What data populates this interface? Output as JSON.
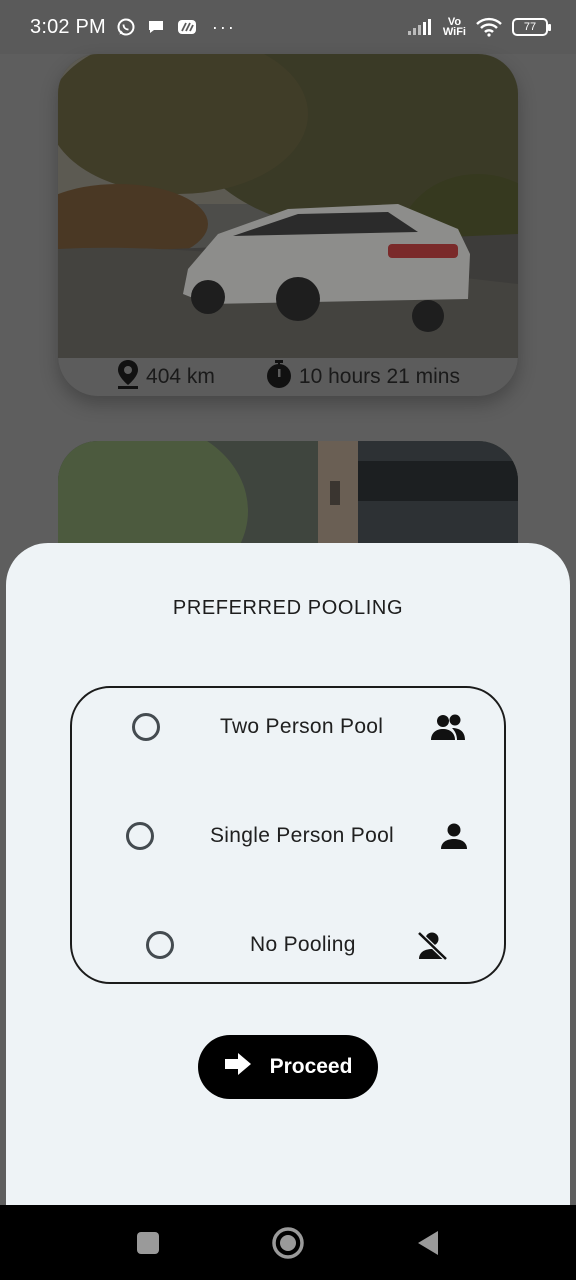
{
  "status_bar": {
    "time": "3:02 PM",
    "dots": "···",
    "network": "Vo WiFi",
    "network_line1": "Vo",
    "network_line2": "WiFi",
    "battery": "77",
    "icons": [
      "whatsapp-icon",
      "chat-bubble-icon",
      "app-icon",
      "signal-icon",
      "wifi-icon",
      "battery-icon"
    ]
  },
  "background": {
    "car_card": {
      "distance": "404 km",
      "duration": "10 hours 21 mins",
      "icons": [
        "location-pin-icon",
        "stopwatch-icon"
      ]
    }
  },
  "sheet": {
    "title": "PREFERRED POOLING",
    "options": [
      {
        "label": "Two Person Pool",
        "icon": "people-icon",
        "selected": false
      },
      {
        "label": "Single Person Pool",
        "icon": "person-icon",
        "selected": false
      },
      {
        "label": "No Pooling",
        "icon": "person-off-icon",
        "selected": false
      }
    ],
    "proceed_label": "Proceed",
    "proceed_icon": "arrow-right-icon"
  },
  "nav_bar": {
    "buttons": [
      "recents-button",
      "home-button",
      "back-button"
    ]
  },
  "colors": {
    "sheet_bg": "#eef3f6",
    "button_bg": "#000000",
    "button_text": "#ffffff",
    "scrim": "#5e5e5e"
  }
}
